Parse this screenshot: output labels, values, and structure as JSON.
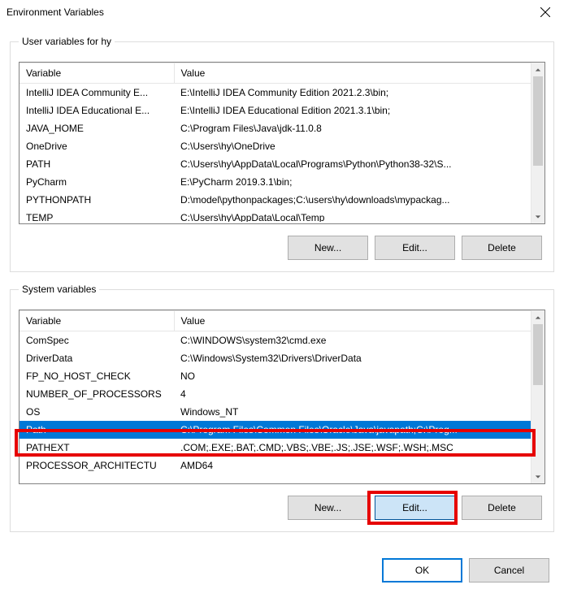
{
  "title": "Environment Variables",
  "user_group": {
    "legend": "User variables for hy",
    "columns": {
      "variable": "Variable",
      "value": "Value"
    },
    "rows": [
      {
        "variable": "IntelliJ IDEA Community E...",
        "value": "E:\\IntelliJ IDEA Community Edition 2021.2.3\\bin;"
      },
      {
        "variable": "IntelliJ IDEA Educational E...",
        "value": "E:\\IntelliJ IDEA Educational Edition 2021.3.1\\bin;"
      },
      {
        "variable": "JAVA_HOME",
        "value": "C:\\Program Files\\Java\\jdk-11.0.8"
      },
      {
        "variable": "OneDrive",
        "value": "C:\\Users\\hy\\OneDrive"
      },
      {
        "variable": "PATH",
        "value": "C:\\Users\\hy\\AppData\\Local\\Programs\\Python\\Python38-32\\S..."
      },
      {
        "variable": "PyCharm",
        "value": "E:\\PyCharm 2019.3.1\\bin;"
      },
      {
        "variable": "PYTHONPATH",
        "value": "D:\\model\\pythonpackages;C:\\users\\hy\\downloads\\mypackag..."
      },
      {
        "variable": "TEMP",
        "value": "C:\\Users\\hy\\AppData\\Local\\Temp"
      }
    ],
    "buttons": {
      "new": "New...",
      "edit": "Edit...",
      "delete": "Delete"
    }
  },
  "system_group": {
    "legend": "System variables",
    "columns": {
      "variable": "Variable",
      "value": "Value"
    },
    "rows": [
      {
        "variable": "ComSpec",
        "value": "C:\\WINDOWS\\system32\\cmd.exe"
      },
      {
        "variable": "DriverData",
        "value": "C:\\Windows\\System32\\Drivers\\DriverData"
      },
      {
        "variable": "FP_NO_HOST_CHECK",
        "value": "NO"
      },
      {
        "variable": "NUMBER_OF_PROCESSORS",
        "value": "4"
      },
      {
        "variable": "OS",
        "value": "Windows_NT"
      },
      {
        "variable": "Path",
        "value": "C:\\Program Files\\Common Files\\Oracle\\Java\\javapath;C:\\Prog...",
        "selected": true
      },
      {
        "variable": "PATHEXT",
        "value": ".COM;.EXE;.BAT;.CMD;.VBS;.VBE;.JS;.JSE;.WSF;.WSH;.MSC"
      },
      {
        "variable": "PROCESSOR_ARCHITECTU",
        "value": "AMD64"
      }
    ],
    "buttons": {
      "new": "New...",
      "edit": "Edit...",
      "delete": "Delete"
    }
  },
  "dialog_buttons": {
    "ok": "OK",
    "cancel": "Cancel"
  }
}
